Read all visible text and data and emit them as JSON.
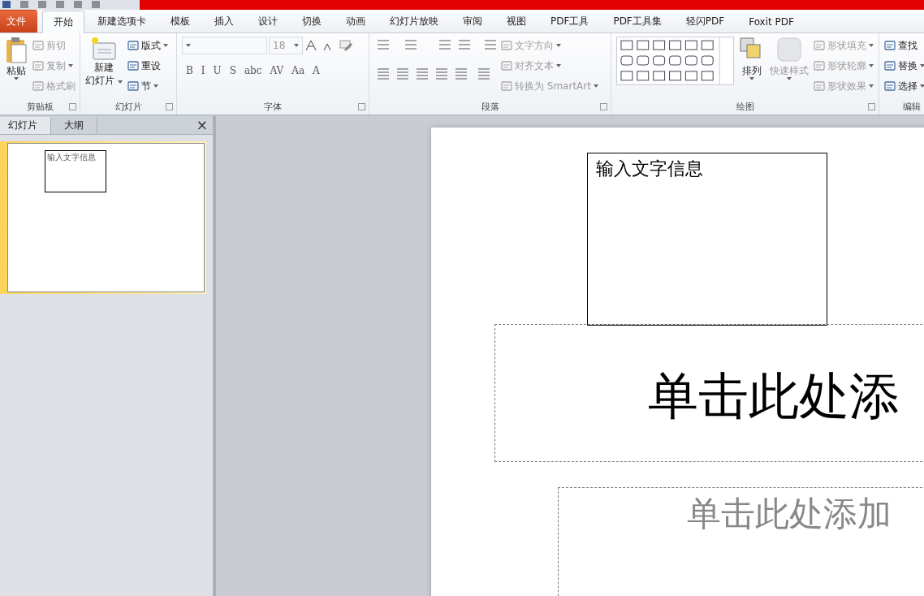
{
  "tabs": [
    {
      "label": "文件",
      "kind": "file",
      "selected": false
    },
    {
      "label": "开始",
      "kind": "tab",
      "selected": true
    },
    {
      "label": "新建选项卡",
      "kind": "tab",
      "selected": false
    },
    {
      "label": "模板",
      "kind": "tab",
      "selected": false
    },
    {
      "label": "插入",
      "kind": "tab",
      "selected": false
    },
    {
      "label": "设计",
      "kind": "tab",
      "selected": false
    },
    {
      "label": "切换",
      "kind": "tab",
      "selected": false
    },
    {
      "label": "动画",
      "kind": "tab",
      "selected": false
    },
    {
      "label": "幻灯片放映",
      "kind": "tab",
      "selected": false
    },
    {
      "label": "审阅",
      "kind": "tab",
      "selected": false
    },
    {
      "label": "视图",
      "kind": "tab",
      "selected": false
    },
    {
      "label": "PDF工具",
      "kind": "tab",
      "selected": false
    },
    {
      "label": "PDF工具集",
      "kind": "tab",
      "selected": false
    },
    {
      "label": "轻闪PDF",
      "kind": "tab",
      "selected": false
    },
    {
      "label": "Foxit PDF",
      "kind": "tab",
      "selected": false
    }
  ],
  "ribbon": [
    {
      "kind": "clipboard",
      "label": "剪贴板",
      "big": {
        "label": "粘贴"
      },
      "items": [
        {
          "label": "剪切",
          "disabled": true,
          "dropdown": false
        },
        {
          "label": "复制",
          "disabled": true,
          "dropdown": true
        },
        {
          "label": "格式刷",
          "disabled": true,
          "dropdown": false
        }
      ]
    },
    {
      "kind": "slides",
      "label": "幻灯片",
      "big": {
        "label": "新建",
        "label2": "幻灯片"
      },
      "items": [
        {
          "label": "版式",
          "disabled": false,
          "dropdown": true
        },
        {
          "label": "重设",
          "disabled": false,
          "dropdown": false
        },
        {
          "label": "节",
          "disabled": false,
          "dropdown": true
        }
      ]
    },
    {
      "kind": "font",
      "label": "字体",
      "size": "18",
      "buttons": [
        "B",
        "I",
        "U",
        "S",
        "abc",
        "AV",
        "Aa",
        "A"
      ]
    },
    {
      "kind": "paragraph",
      "label": "段落",
      "items": [
        {
          "label": "文字方向",
          "disabled": true,
          "dropdown": true
        },
        {
          "label": "对齐文本",
          "disabled": true,
          "dropdown": true
        },
        {
          "label": "转换为 SmartArt",
          "disabled": true,
          "dropdown": true
        }
      ]
    },
    {
      "kind": "drawing",
      "label": "绘图",
      "arrange": {
        "label": "排列",
        "disabled": false
      },
      "quick": {
        "label": "快速样式",
        "disabled": true
      },
      "items": [
        {
          "label": "形状填充",
          "disabled": true,
          "dropdown": true
        },
        {
          "label": "形状轮廓",
          "disabled": true,
          "dropdown": true
        },
        {
          "label": "形状效果",
          "disabled": true,
          "dropdown": true
        }
      ]
    },
    {
      "kind": "editing",
      "label": "编辑",
      "items": [
        {
          "label": "查找",
          "disabled": false,
          "dropdown": false
        },
        {
          "label": "替换",
          "disabled": false,
          "dropdown": true
        },
        {
          "label": "选择",
          "disabled": false,
          "dropdown": true
        }
      ]
    }
  ],
  "side_panel": {
    "tabs": [
      {
        "label": "幻灯片",
        "selected": true
      },
      {
        "label": "大纲",
        "selected": false
      }
    ],
    "close": "×",
    "thumbnails": [
      {
        "text": "输入文字信息",
        "selected": true
      }
    ]
  },
  "slide": {
    "text_box": "输入文字信息",
    "title_placeholder": "单击此处添",
    "subtitle_placeholder": "单击此处添加"
  }
}
